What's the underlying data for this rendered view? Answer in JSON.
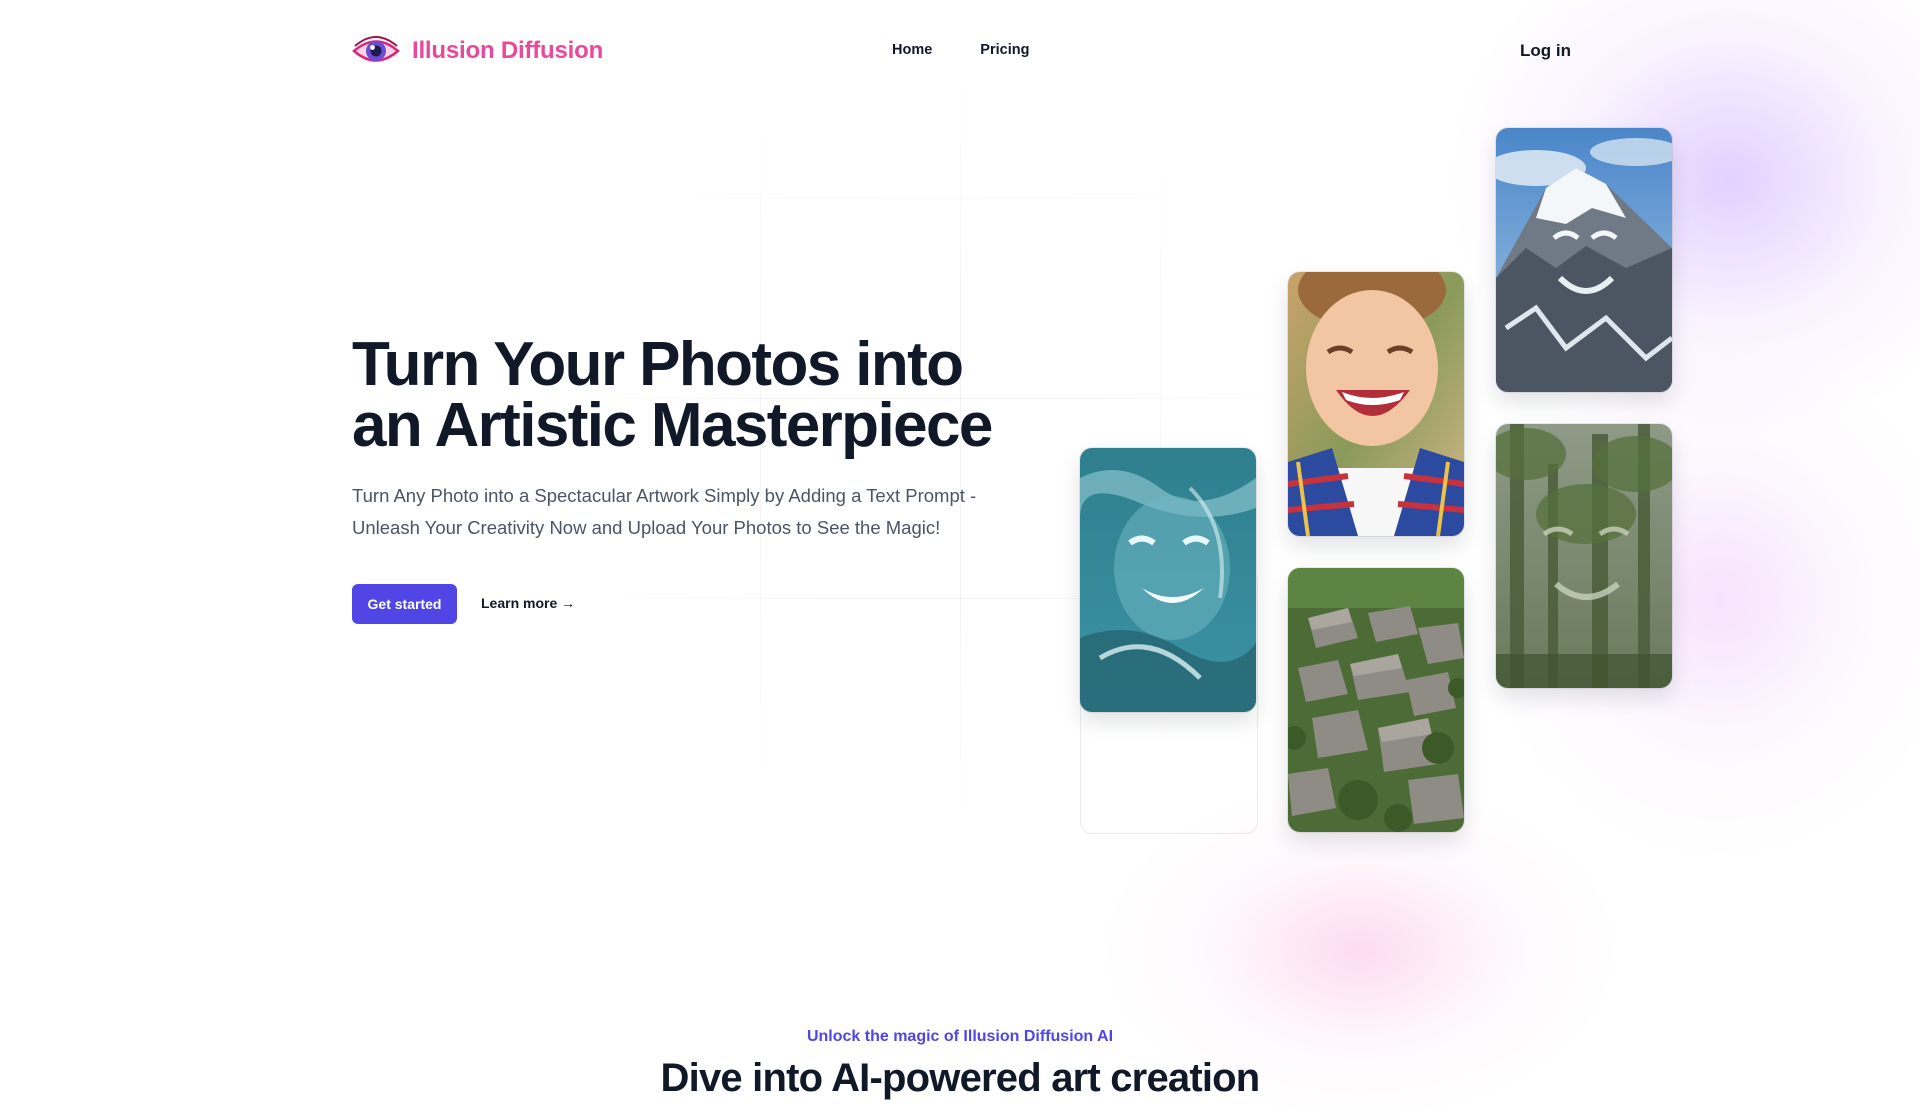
{
  "brand": {
    "name": "Illusion Diffusion",
    "logo_icon": "eye-icon",
    "accent": "#ec4899"
  },
  "nav": {
    "items": [
      {
        "label": "Home"
      },
      {
        "label": "Pricing"
      }
    ],
    "login_label": "Log in"
  },
  "hero": {
    "title_line1": "Turn Your Photos into",
    "title_line2": "an Artistic Masterpiece",
    "subtitle_line1": "Turn Any Photo into a Spectacular Artwork Simply by Adding a Text Prompt -",
    "subtitle_line2": "Unleash Your Creativity Now and Upload Your Photos to See the Magic!",
    "primary_cta": "Get started",
    "primary_color": "#4f46e5",
    "secondary_cta": "Learn more →"
  },
  "gallery": [
    {
      "image": "ocean-waves-face-image"
    },
    {
      "image": "laughing-child-image"
    },
    {
      "image": "stone-village-image"
    },
    {
      "image": "snowy-mountain-face-image"
    },
    {
      "image": "forest-face-image"
    }
  ],
  "section": {
    "eyebrow": "Unlock the magic of Illusion Diffusion AI",
    "title": "Dive into AI-powered art creation"
  }
}
